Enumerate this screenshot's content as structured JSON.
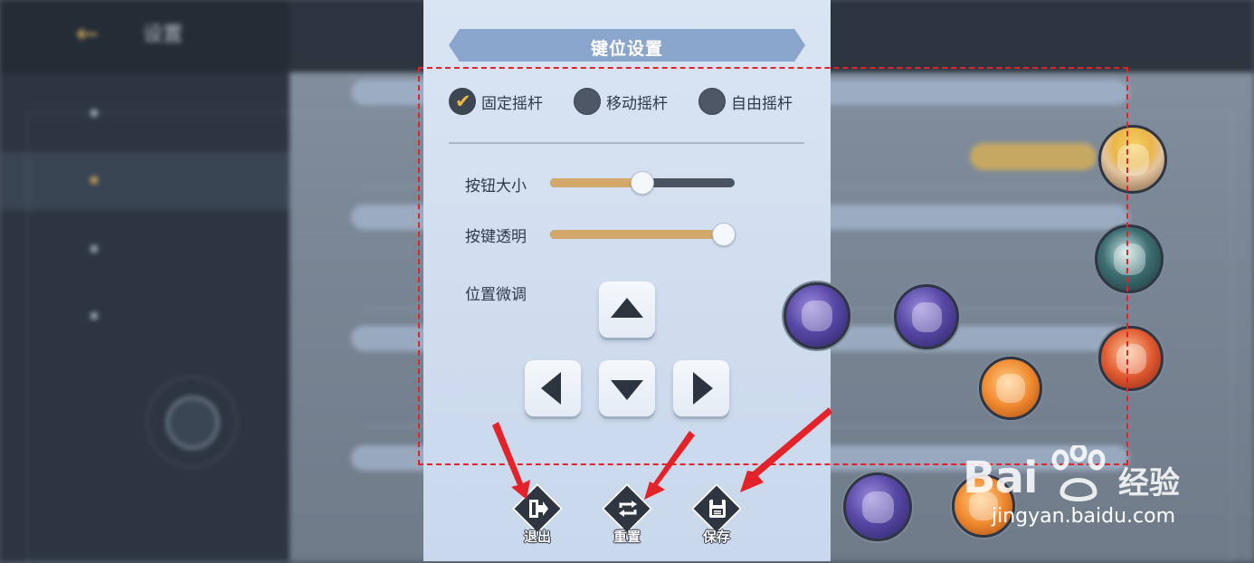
{
  "dialog": {
    "title": "键位设置",
    "joystick_modes": [
      {
        "label": "固定摇杆",
        "checked": true
      },
      {
        "label": "移动摇杆",
        "checked": false
      },
      {
        "label": "自由摇杆",
        "checked": false
      }
    ],
    "sliders": [
      {
        "label": "按钮大小",
        "value_fraction": 0.5
      },
      {
        "label": "按键透明",
        "value_fraction": 0.94
      }
    ],
    "position_adjust_label": "位置微调",
    "actions": [
      {
        "label": "退出",
        "icon": "exit-icon"
      },
      {
        "label": "重置",
        "icon": "reset-icon"
      },
      {
        "label": "保存",
        "icon": "save-icon"
      }
    ]
  },
  "background": {
    "title": "设置"
  },
  "watermark": {
    "brand": "Bai",
    "brand_suffix": "经验",
    "url": "jingyan.baidu.com"
  },
  "colors": {
    "panel_bg": "#d2deef",
    "header_bg": "#8aa6cc",
    "slider_fill": "#d2a96a",
    "slider_track": "#4c5462",
    "check_color": "#ecbb3a",
    "annotation_red": "#e3222a"
  }
}
